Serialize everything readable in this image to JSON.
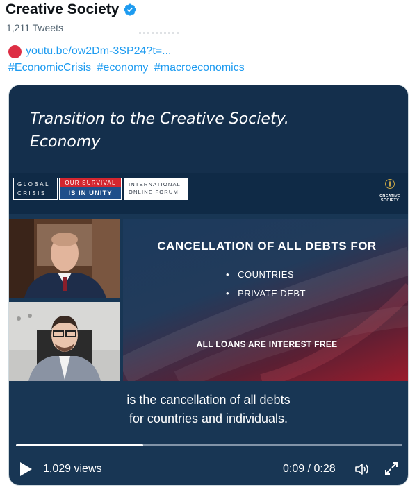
{
  "account": {
    "display_name": "Creative Society",
    "verified_icon": "verified-badge-icon",
    "tweet_count": "1,211 Tweets"
  },
  "tweet": {
    "link_icon": "red-circle-emoji",
    "link_text": "youtu.be/ow2Dm-3SP24?t=...",
    "hashtags": [
      "#EconomicCrisis",
      "#economy",
      "#macroeconomics"
    ]
  },
  "video": {
    "title_line1": "Transition to the Creative Society.",
    "title_line2": "Economy",
    "banner": {
      "global_crisis_line1": "GLOBAL",
      "global_crisis_line2": "CRISIS",
      "survival_top": "OUR SURVIVAL",
      "survival_bottom": "IS IN UNITY",
      "forum_line1": "INTERNATIONAL",
      "forum_line2": "ONLINE FORUM",
      "logo_line1": "CREATIVE",
      "logo_line2": "SOCIETY"
    },
    "slide": {
      "heading": "CANCELLATION OF ALL DEBTS FOR",
      "items": [
        "COUNTRIES",
        "PRIVATE DEBT"
      ],
      "footer": "ALL LOANS ARE INTEREST FREE"
    },
    "subtitle_line1": "is the cancellation of all debts",
    "subtitle_line2": "for countries and individuals.",
    "progress_fraction": 0.33,
    "views": "1,029 views",
    "time": "0:09 / 0:28",
    "icons": {
      "play": "play-icon",
      "volume": "volume-icon",
      "fullscreen": "fullscreen-icon"
    }
  },
  "colors": {
    "link": "#1d9bf0",
    "verified": "#1d9bf0",
    "banner_red": "#d3262f",
    "banner_blue": "#1f4f8a"
  }
}
